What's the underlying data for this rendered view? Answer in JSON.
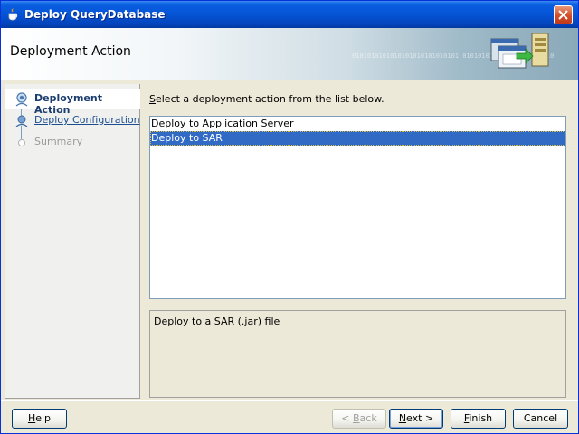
{
  "window": {
    "title": "Deploy QueryDatabase"
  },
  "banner": {
    "title": "Deployment Action",
    "binary_text": "0101010101010101010101010101 010101010101 01010101010"
  },
  "steps": [
    {
      "label": "Deployment Action",
      "state": "active"
    },
    {
      "label": "Deploy Configuration",
      "state": "link"
    },
    {
      "label": "Summary",
      "state": "disabled"
    }
  ],
  "main": {
    "instruction": "Select a deployment action from the list below.",
    "actions": [
      {
        "label": "Deploy to Application Server",
        "selected": false
      },
      {
        "label": "Deploy to SAR",
        "selected": true
      }
    ],
    "description": "Deploy to a SAR (.jar) file"
  },
  "buttons": {
    "help": "Help",
    "back": "< Back",
    "next": "Next >",
    "finish": "Finish",
    "cancel": "Cancel"
  },
  "colors": {
    "selection": "#316ac5",
    "titlebar": "#0554d6",
    "accent_link": "#1a4e91"
  }
}
